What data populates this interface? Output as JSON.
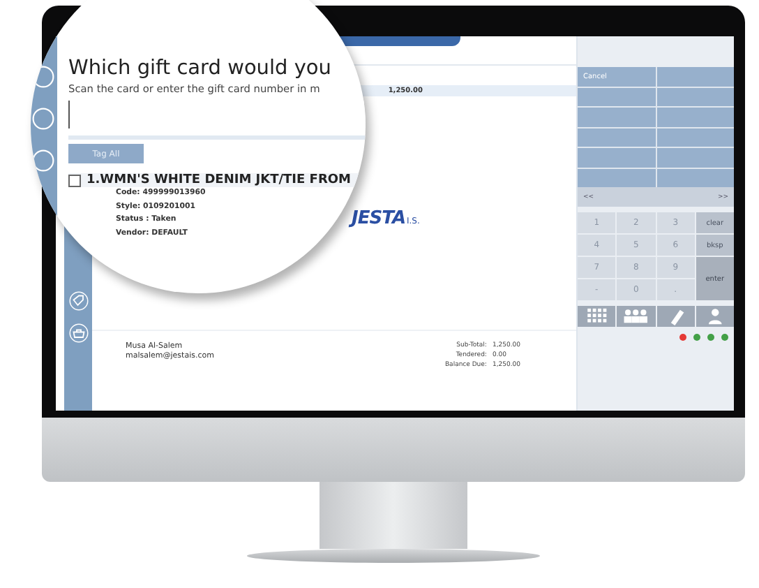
{
  "magnifier": {
    "heading": "Which gift card would you",
    "instruction": "Scan the card or enter the gift card number in m",
    "tag_button": "Tag All",
    "item": {
      "title": "1.WMN'S WHITE DENIM JKT/TIE FROM",
      "checked": false,
      "details": [
        "Code: 499999013960",
        "Style: 0109201001",
        "Status : Taken",
        "Vendor: DEFAULT"
      ]
    }
  },
  "order": {
    "amount": "1,250.00"
  },
  "logo": {
    "name": "JESTA",
    "suffix": "I.S."
  },
  "customer": {
    "name": "Musa Al-Salem",
    "email": "malsalem@jestais.com"
  },
  "totals": [
    {
      "label": "Sub-Total:",
      "value": "1,250.00"
    },
    {
      "label": "Tendered:",
      "value": "0.00"
    },
    {
      "label": "Balance Due:",
      "value": "1,250.00"
    }
  ],
  "action_panel": {
    "cancel": "Cancel",
    "prev": "<<",
    "next": ">>"
  },
  "keypad": [
    {
      "label": "1",
      "kind": "digit"
    },
    {
      "label": "2",
      "kind": "digit"
    },
    {
      "label": "3",
      "kind": "digit"
    },
    {
      "label": "clear",
      "kind": "action"
    },
    {
      "label": "4",
      "kind": "digit"
    },
    {
      "label": "5",
      "kind": "digit"
    },
    {
      "label": "6",
      "kind": "digit"
    },
    {
      "label": "bksp",
      "kind": "action"
    },
    {
      "label": "7",
      "kind": "digit"
    },
    {
      "label": "8",
      "kind": "digit"
    },
    {
      "label": "9",
      "kind": "digit"
    },
    {
      "label": "enter",
      "kind": "tall"
    },
    {
      "label": "-",
      "kind": "digit"
    },
    {
      "label": "0",
      "kind": "digit"
    },
    {
      "label": ".",
      "kind": "digit"
    }
  ],
  "status_lights": [
    {
      "color": "#e53935"
    },
    {
      "color": "#43a047"
    },
    {
      "color": "#43a047"
    },
    {
      "color": "#43a047"
    }
  ]
}
